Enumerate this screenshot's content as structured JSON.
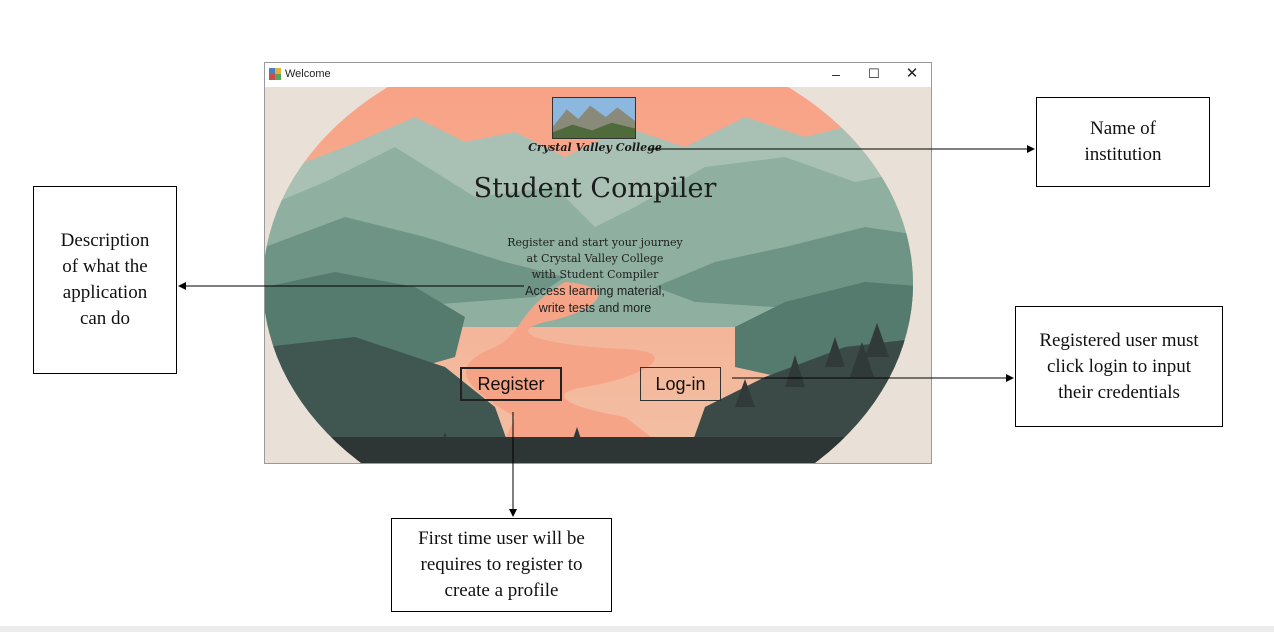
{
  "window": {
    "title": "Welcome",
    "minimize_glyph": "–",
    "maximize_glyph": "☐",
    "close_glyph": "✕"
  },
  "app": {
    "institution": "Crystal Valley College",
    "title": "Student Compiler",
    "description_lines": [
      "Register and start your journey",
      "at Crystal Valley College",
      "with Student Compiler"
    ],
    "feature_lines": [
      "Access learning material,",
      "write tests and more"
    ],
    "register_label": "Register",
    "login_label": "Log-in"
  },
  "annotations": {
    "institution": "Name of\ninstitution",
    "description": "Description\nof what the\napplication\ncan do",
    "login": "Registered user must\nclick login to input\ntheir credentials",
    "register": "First time user will be\nrequires to register to\ncreate a profile"
  },
  "colors": {
    "sky": "#f6a88a",
    "lake": "#f5a487",
    "mountain_light": "#8fb0a0",
    "mountain_mid": "#6e9486",
    "forest_dark": "#3b4a47",
    "backdrop": "#e9e1d7"
  }
}
